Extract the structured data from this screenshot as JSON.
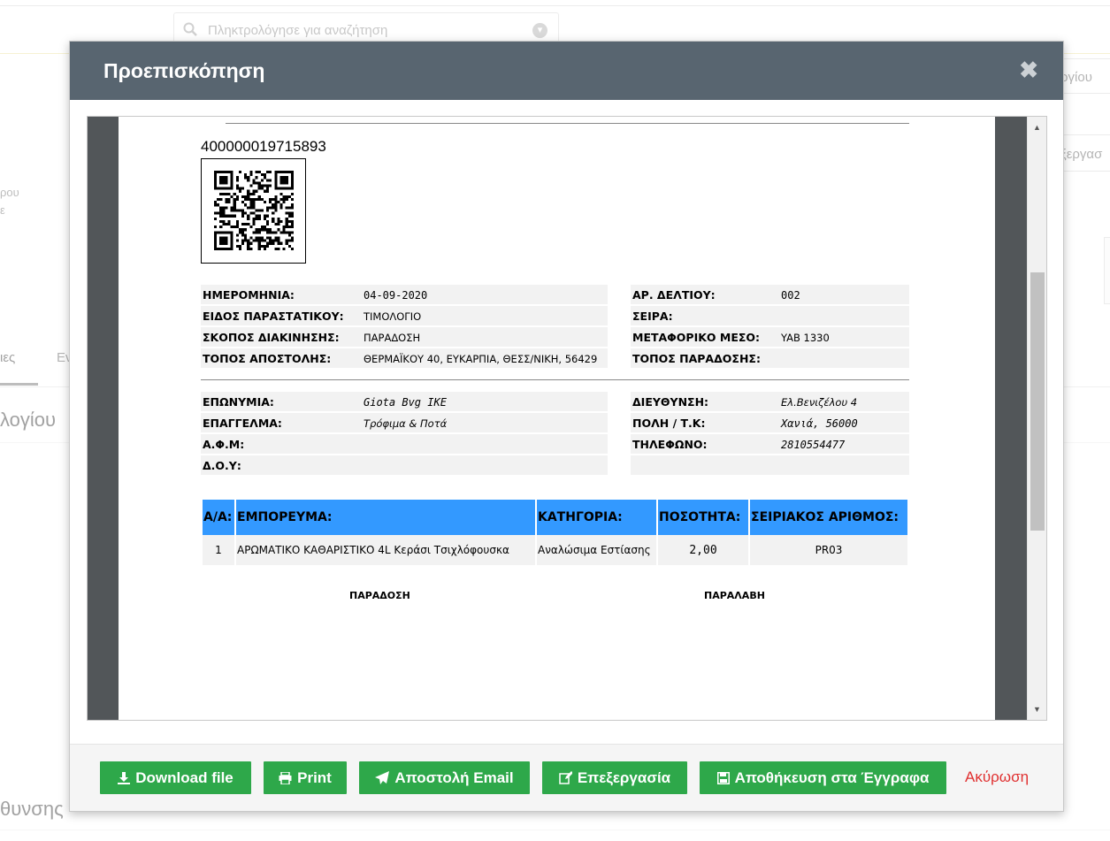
{
  "background": {
    "search_placeholder": "Πληκτρολόγησε για αναζήτηση",
    "right_button_1": "ργίου",
    "right_button_2": "ξεργασ",
    "left_text_1": "ρου",
    "left_text_2": "ε",
    "tab_1": "ιες",
    "tab_2": "Εν",
    "heading": "λογίου",
    "footer_heading": "θυνσης"
  },
  "modal": {
    "title": "Προεπισκόπηση",
    "close_glyph": "✖"
  },
  "document": {
    "barcode_number": "400000019715893",
    "left_info": [
      {
        "label": "ΗΜΕΡΟΜΗΝΙΑ:",
        "value": "04-09-2020"
      },
      {
        "label": "ΕΙΔΟΣ ΠΑΡΑΣΤΑΤΙΚΟΥ:",
        "value": "ΤΙΜΟΛΟΓΙΟ"
      },
      {
        "label": "ΣΚΟΠΟΣ ΔΙΑΚΙΝΗΣΗΣ:",
        "value": "ΠΑΡΑΔΟΣΗ"
      },
      {
        "label": "ΤΟΠΟΣ ΑΠΟΣΤΟΛΗΣ:",
        "value": "ΘΕΡΜΑΪΚΟΥ 40, ΕΥΚΑΡΠΙΑ, ΘΕΣΣ/ΝΙΚΗ, 56429"
      }
    ],
    "right_info": [
      {
        "label": "ΑΡ. ΔΕΛΤΙΟΥ:",
        "value": "002"
      },
      {
        "label": "ΣΕΙΡΑ:",
        "value": ""
      },
      {
        "label": "ΜΕΤΑΦΟΡΙΚΟ ΜΕΣΟ:",
        "value": "YAB 1330"
      },
      {
        "label": "ΤΟΠΟΣ ΠΑΡΑΔΟΣΗΣ:",
        "value": ""
      }
    ],
    "left_customer": [
      {
        "label": "ΕΠΩΝΥΜΙΑ:",
        "value": "Giota Bvg IKE"
      },
      {
        "label": "ΕΠΑΓΓΕΛΜΑ:",
        "value": "Τρόφιμα & Ποτά"
      },
      {
        "label": "Α.Φ.Μ:",
        "value": ""
      },
      {
        "label": "Δ.Ο.Υ:",
        "value": ""
      }
    ],
    "right_customer": [
      {
        "label": "ΔΙΕΥΘΥΝΣΗ:",
        "value": "Ελ.Βενιζέλου 4"
      },
      {
        "label": "ΠΟΛΗ / Τ.Κ:",
        "value": "Χανιά, 56000"
      },
      {
        "label": "ΤΗΛΕΦΩΝΟ:",
        "value": "2810554477"
      },
      {
        "label": "",
        "value": ""
      }
    ],
    "table": {
      "headers": [
        "Α/Α:",
        "ΕΜΠΟΡΕΥΜΑ:",
        "ΚΑΤΗΓΟΡΙΑ:",
        "ΠΟΣΟΤΗΤΑ:",
        "ΣΕΙΡΙΑΚΟΣ ΑΡΙΘΜΟΣ:"
      ],
      "rows": [
        [
          "1",
          "ΑΡΩΜΑΤΙΚΟ ΚΑΘΑΡΙΣΤΙΚΟ 4L Κεράσι Τσιχλόφουσκα",
          "Αναλώσιμα Εστίασης",
          "2,00",
          "PR03"
        ]
      ]
    },
    "signature_left": "ΠΑΡΑΔΟΣΗ",
    "signature_right": "ΠΑΡΑΛΑΒΗ"
  },
  "footer": {
    "download_label": "Download file",
    "print_label": "Print",
    "email_label": "Αποστολή Email",
    "edit_label": "Επεξεργασία",
    "save_label": "Αποθήκευση στα Έγγραφα",
    "cancel_label": "Ακύρωση"
  },
  "colors": {
    "header_bg": "#586570",
    "button_green": "#2ea84a",
    "table_header_blue": "#3399ff",
    "cancel_red": "#e03030"
  }
}
